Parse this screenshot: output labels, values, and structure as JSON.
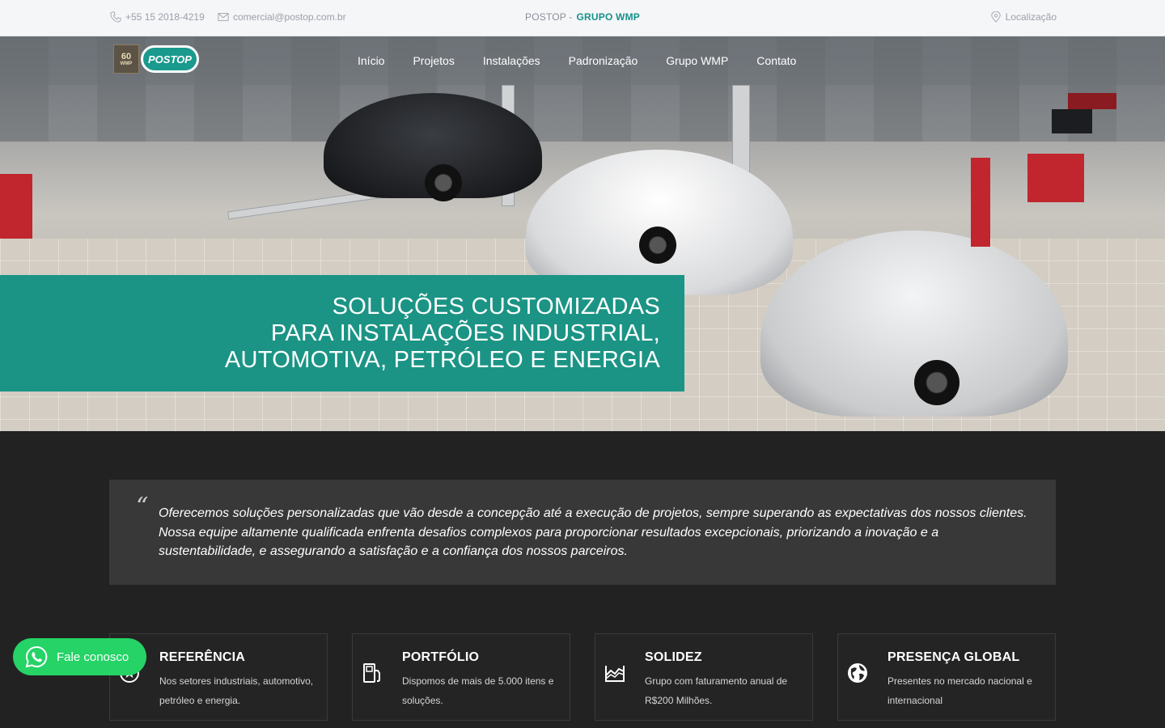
{
  "topbar": {
    "phone": "+55 15 2018-4219",
    "email": "comercial@postop.com.br",
    "brand_main": "POSTOP -",
    "brand_accent": "GRUPO WMP",
    "location": "Localização"
  },
  "logo": {
    "badge": "60",
    "badge_sub": "WMP",
    "name": "POSTOP"
  },
  "nav": {
    "items": [
      "Início",
      "Projetos",
      "Instalações",
      "Padronização",
      "Grupo WMP",
      "Contato"
    ]
  },
  "hero": {
    "lines": [
      "SOLUÇÕES CUSTOMIZADAS",
      "PARA INSTALAÇÕES INDUSTRIAL,",
      "AUTOMOTIVA, PETRÓLEO E ENERGIA"
    ]
  },
  "quote": {
    "text": "Oferecemos soluções personalizadas que vão desde a concepção até a execução de projetos, sempre superando as expectativas dos nossos clientes. Nossa equipe altamente qualificada enfrenta desafios complexos para proporcionar resultados excepcionais, priorizando a inovação e a sustentabilidade, e assegurando a satisfação e a confiança dos nossos parceiros."
  },
  "features": [
    {
      "title": "REFERÊNCIA",
      "text": "Nos setores industriais, automotivo, petróleo e energia.",
      "icon": "star-badge-icon"
    },
    {
      "title": "PORTFÓLIO",
      "text": "Dispomos de mais de 5.000 itens e soluções.",
      "icon": "fuel-pump-icon"
    },
    {
      "title": "SOLIDEZ",
      "text": "Grupo com faturamento anual de R$200 Milhões.",
      "icon": "chart-icon"
    },
    {
      "title": "PRESENÇA GLOBAL",
      "text": "Presentes no mercado nacional e internacional",
      "icon": "globe-icon"
    }
  ],
  "whatsapp": {
    "label": "Fale conosco"
  },
  "colors": {
    "accent": "#1b9485",
    "dark_bg": "#222222",
    "whatsapp": "#25d366"
  }
}
